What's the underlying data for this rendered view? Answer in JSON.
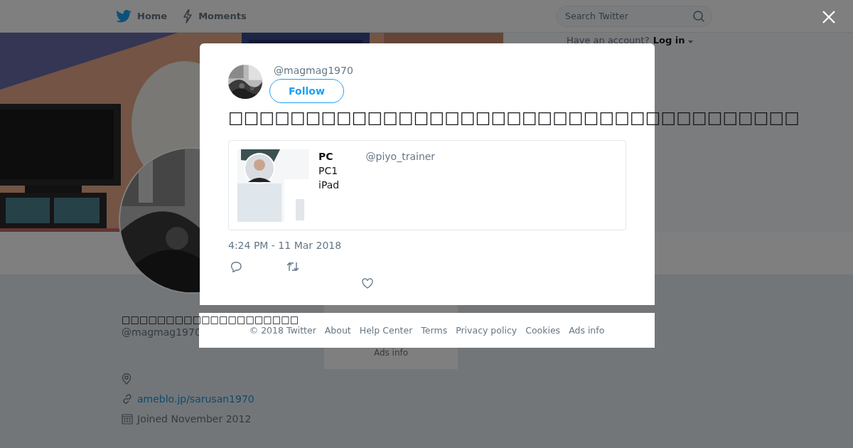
{
  "topbar": {
    "nav": [
      {
        "kind": "home",
        "label": "Home"
      },
      {
        "kind": "moments",
        "label": "Moments"
      }
    ],
    "search": {
      "placeholder": "Search Twitter"
    },
    "login": {
      "prompt": "Have an account?",
      "link": "Log in"
    }
  },
  "profile": {
    "name": "□□□□□□□□□□□□□□□□□□□□",
    "handle": "@magmag1970",
    "link": "ameblo.jp/sarusan1970",
    "joined": "Joined November 2012"
  },
  "side_footer": {
    "links": [
      "Ads info"
    ]
  },
  "tweet": {
    "handle": "@magmag1970",
    "follow": "Follow",
    "text": "□□□□□□□□□□□□□□□□□□□□□□□□□□□□□□□□□□□□□",
    "quote": {
      "name": "PC",
      "handle": "@piyo_trainer",
      "lines": [
        "PC1",
        "iPad"
      ]
    },
    "time": "4:24 PM - 11 Mar 2018"
  },
  "footer": {
    "links": [
      "© 2018 Twitter",
      "About",
      "Help Center",
      "Terms",
      "Privacy policy",
      "Cookies",
      "Ads info"
    ]
  }
}
